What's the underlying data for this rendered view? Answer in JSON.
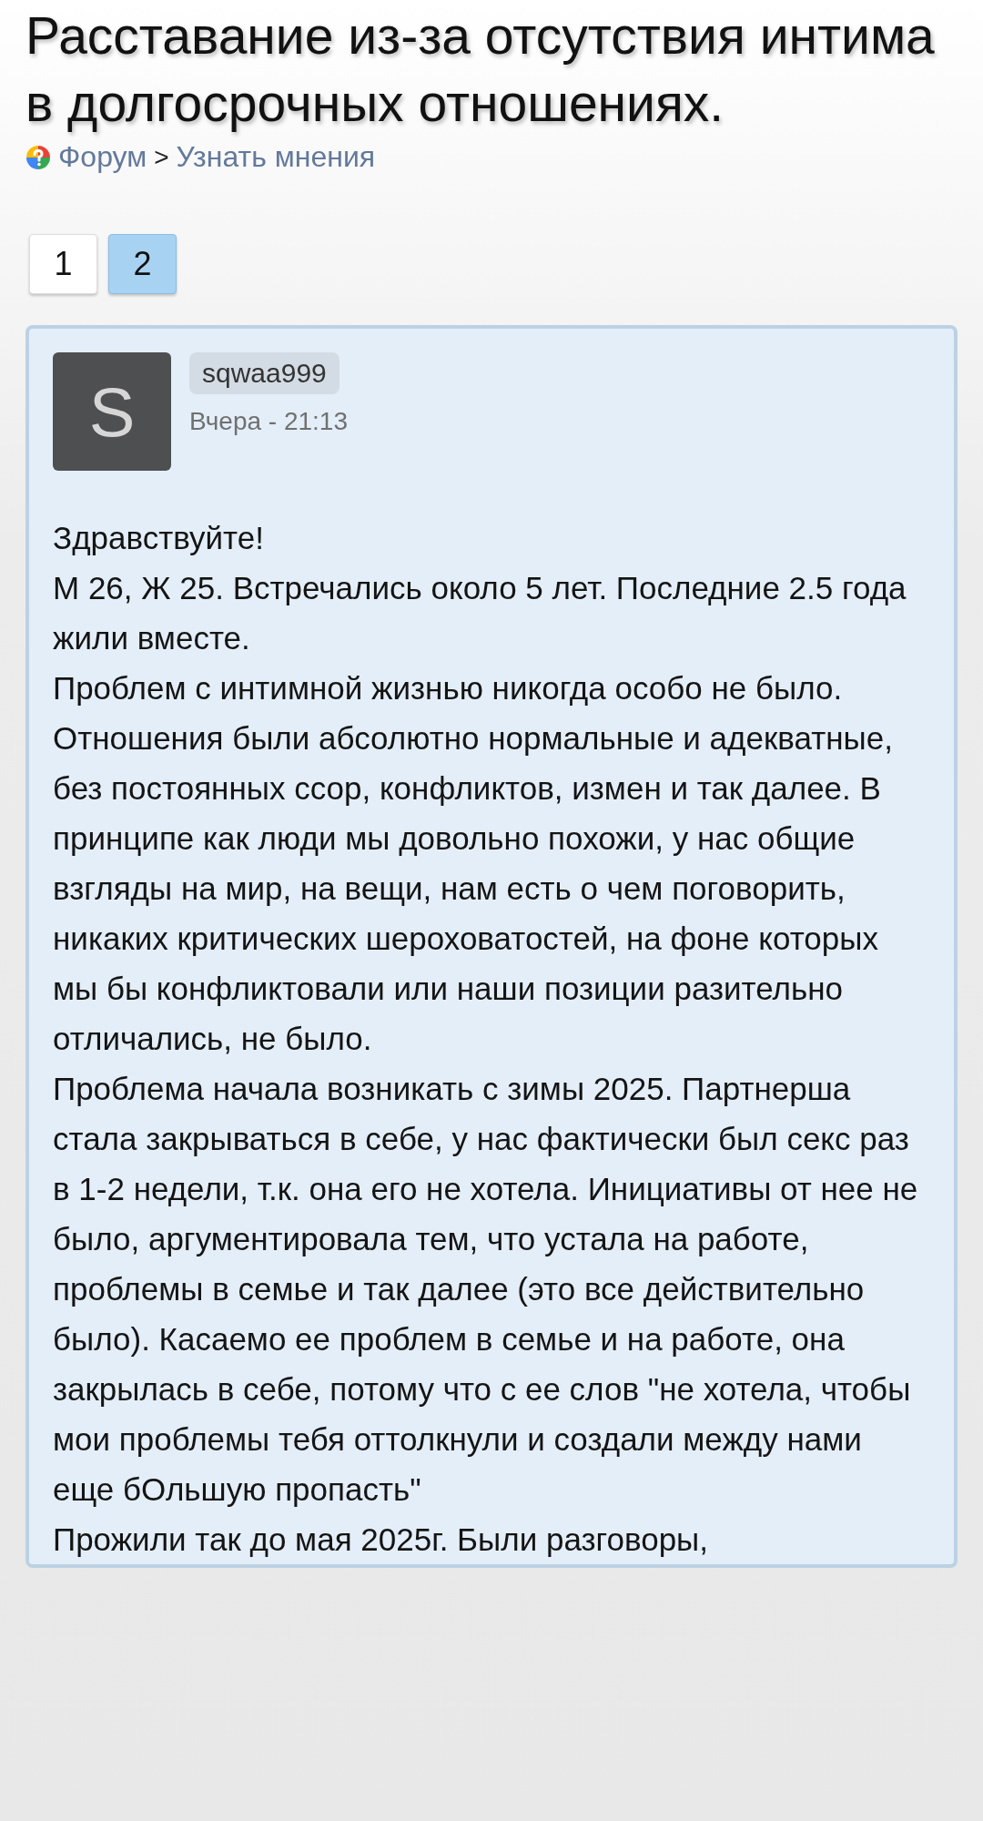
{
  "title": "Расставание из-за отсутствия интима в долгосрочных отношениях.",
  "breadcrumbs": [
    {
      "label": "Форум"
    },
    {
      "label": "Узнать мнения"
    }
  ],
  "breadcrumb_separator": ">",
  "pages": [
    {
      "label": "1",
      "selected": false
    },
    {
      "label": "2",
      "selected": true
    }
  ],
  "post": {
    "avatar_letter": "S",
    "author": "sqwaa999",
    "time": "Вчера - 21:13",
    "paragraphs": [
      "Здравствуйте!",
      "М 26, Ж 25. Встречались около 5 лет. Последние 2.5 года жили вместе.",
      "Проблем с интимной жизнью никогда особо не было. Отношения были абсолютно нормальные и адекватные, без постоянных ссор, конфликтов, измен и так далее. В принципе как люди мы довольно похожи, у нас общие взгляды на мир, на вещи, нам есть о чем поговорить, никаких критических шероховатостей, на фоне которых мы бы конфликтовали или наши позиции разительно отличались, не было.",
      "Проблема начала возникать с зимы 2025. Партнерша стала закрываться в себе, у нас фактически был секс раз в 1-2 недели, т.к. она его не хотела. Инициативы от нее не было, аргументировала тем, что устала на работе, проблемы в семье и так далее (это все действительно было). Касаемо ее проблем в семье и на работе, она закрылась в себе, потому что с ее слов \"не хотела, чтобы мои проблемы тебя оттолкнули и создали между нами еще бОльшую пропасть\"",
      "Прожили так до мая 2025г. Были разговоры,"
    ]
  }
}
